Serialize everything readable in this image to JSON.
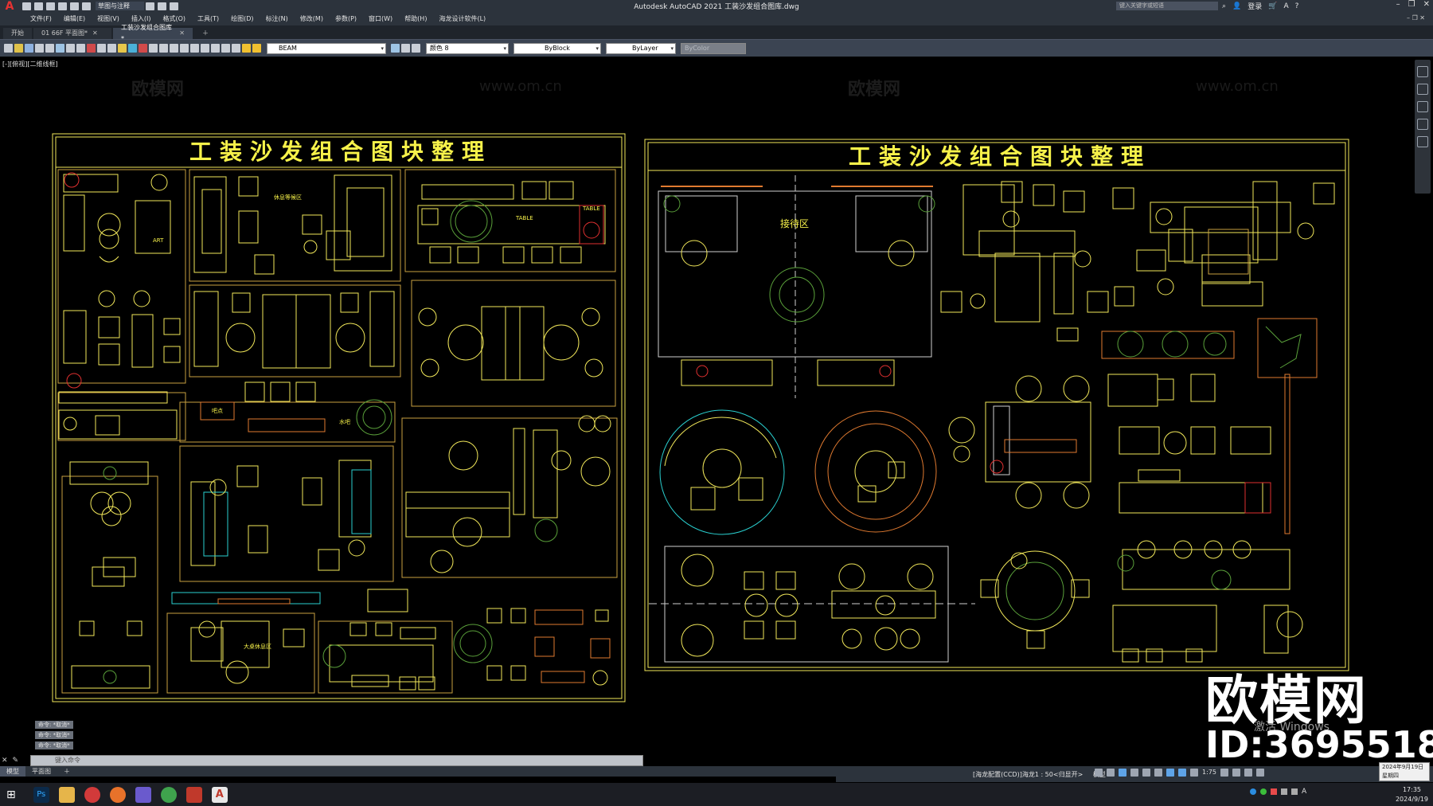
{
  "app": {
    "logo": "A",
    "workspace": "草图与注释",
    "title": "Autodesk AutoCAD 2021    工装沙发组合图库.dwg",
    "search_placeholder": "键入关键字或短语",
    "user": "登录"
  },
  "menu": [
    "文件(F)",
    "编辑(E)",
    "视图(V)",
    "插入(I)",
    "格式(O)",
    "工具(T)",
    "绘图(D)",
    "标注(N)",
    "修改(M)",
    "参数(P)",
    "窗口(W)",
    "帮助(H)",
    "海龙设计软件(L)"
  ],
  "tabs": [
    {
      "label": "开始"
    },
    {
      "label": "01 66F 平面图*"
    },
    {
      "label": "工装沙发组合图库*"
    }
  ],
  "toolbar": {
    "layer": "BEAM",
    "color": "颜色 8",
    "linetype": "ByBlock",
    "lineweight": "ByLayer",
    "plotstyle": "ByColor"
  },
  "viewport": {
    "label": "[-][俯视][二维线框]"
  },
  "watermarks": {
    "brand": "欧模网",
    "url": "www.om.cn"
  },
  "drawing": {
    "title_left": "工装沙发组合图块整理",
    "title_right": "工装沙发组合图块整理",
    "labels": {
      "rest_area": "休息等候区",
      "reception": "接待区",
      "table_label": "TABLE",
      "big_table": "大桌休息区",
      "art": "ART",
      "point": "吧点",
      "water": "水吧"
    }
  },
  "command": {
    "history": [
      "命令: *取消*",
      "命令: *取消*",
      "命令: *取消*"
    ],
    "placeholder": "键入命令"
  },
  "layout_tabs": [
    "模型",
    "平面图"
  ],
  "status": {
    "annotation": "[海龙配置(CCD)]海龙1 : 50<归显开>",
    "model": "模型",
    "scale": "1:75"
  },
  "overlay": {
    "logo_text": "欧模网",
    "id_text": "ID:3695518",
    "activate": "激活 Windows"
  },
  "clock": {
    "time": "17:35",
    "date": "2024/9/19",
    "badge_date": "2024年9月19日",
    "badge_day": "星期四"
  },
  "colors": {
    "title_yellow": "#f7f24a",
    "frame": "#f2e85a",
    "red": "#e03030",
    "green": "#5aa03a",
    "cyan": "#2ad0d0"
  }
}
